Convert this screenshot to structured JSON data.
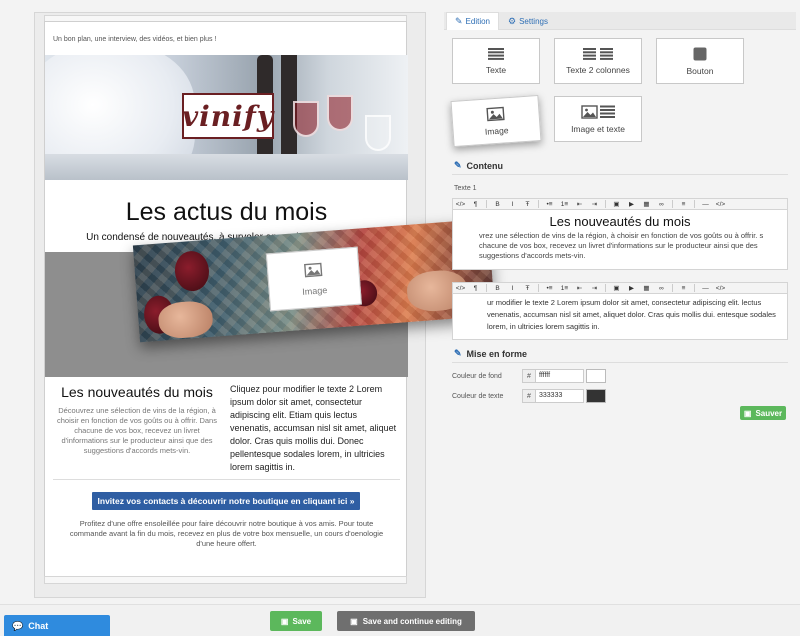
{
  "email": {
    "preheader": "Un bon plan, une interview, des vidéos, et bien plus !",
    "logo_text": "vinify",
    "title": "Les actus du mois",
    "subtitle": "Un condensé de nouveautés, à survoler en quelques minutes :)",
    "left_heading": "Les nouveautés du mois",
    "left_text": "Découvrez une sélection de vins de la région, à choisir en fonction de vos goûts ou à offrir. Dans chacune de vos box, recevez un livret d'informations sur le producteur ainsi que des suggestions d'accords mets-vin.",
    "right_text": "Cliquez pour modifier le texte 2 Lorem ipsum dolor sit amet, consectetur adipiscing elit. Etiam quis lectus venenatis, accumsan nisl sit amet, aliquet dolor. Cras quis mollis dui. Donec pellentesque sodales lorem, in ultricies lorem sagittis in.",
    "cta_label": "Invitez vos contacts à découvrir notre boutique en cliquant ici »",
    "footer_text": "Profitez d'une offre ensoleillée pour faire découvrir notre boutique à vos amis. Pour toute commande avant la fin du mois, recevez en plus de votre box mensuelle, un cours d'oenologie d'une heure offert."
  },
  "drag_block": {
    "label": "Image"
  },
  "panel": {
    "tabs": [
      {
        "label": "Edition",
        "icon": "pencil-icon",
        "active": true
      },
      {
        "label": "Settings",
        "icon": "gears-icon",
        "active": false
      }
    ],
    "blocks": [
      {
        "label": "Texte",
        "icon": "lines-icon"
      },
      {
        "label": "Texte 2 colonnes",
        "icon": "two-columns-icon"
      },
      {
        "label": "Bouton",
        "icon": "button-square-icon"
      },
      {
        "label": "Image",
        "icon": "image-icon"
      },
      {
        "label": "Image et texte",
        "icon": "image-text-icon"
      }
    ],
    "content_section": "Contenu",
    "text1_label": "Texte 1",
    "toolbar_items": [
      "</>",
      "¶",
      "B",
      "I",
      "Ŧ",
      "•≡",
      "1≡",
      "⇤",
      "⇥",
      "▣",
      "▶",
      "▦",
      "∞",
      "≡",
      "—",
      "</>"
    ],
    "editor1": {
      "heading": "Les nouveautés du mois",
      "text": "vrez une sélection de vins de la région, à choisir en fonction de vos goûts ou à offrir. s chacune de vos box, recevez un livret d'informations sur le producteur ainsi que des suggestions d'accords mets-vin."
    },
    "editor2": {
      "text": "ur modifier le texte 2 Lorem ipsum dolor sit amet, consectetur adipiscing elit. lectus venenatis, accumsan nisl sit amet, aliquet dolor. Cras quis mollis dui. entesque sodales lorem, in ultricies lorem sagittis in."
    },
    "format_section": "Mise en forme",
    "bg_color": {
      "label": "Couleur de fond",
      "hash": "#",
      "value": "ffffff",
      "swatch": "#ffffff"
    },
    "text_color": {
      "label": "Couleur de texte",
      "hash": "#",
      "value": "333333",
      "swatch": "#333333"
    },
    "save_label": "Sauver"
  },
  "bottom": {
    "chat_label": "Chat",
    "save_label": "Save",
    "save_continue_label": "Save and continue editing"
  },
  "colors": {
    "accent": "#2f6fb5",
    "cta": "#2f5ea3",
    "success": "#5cb85c",
    "chat": "#2f8bde",
    "logo": "#6a1f22"
  }
}
